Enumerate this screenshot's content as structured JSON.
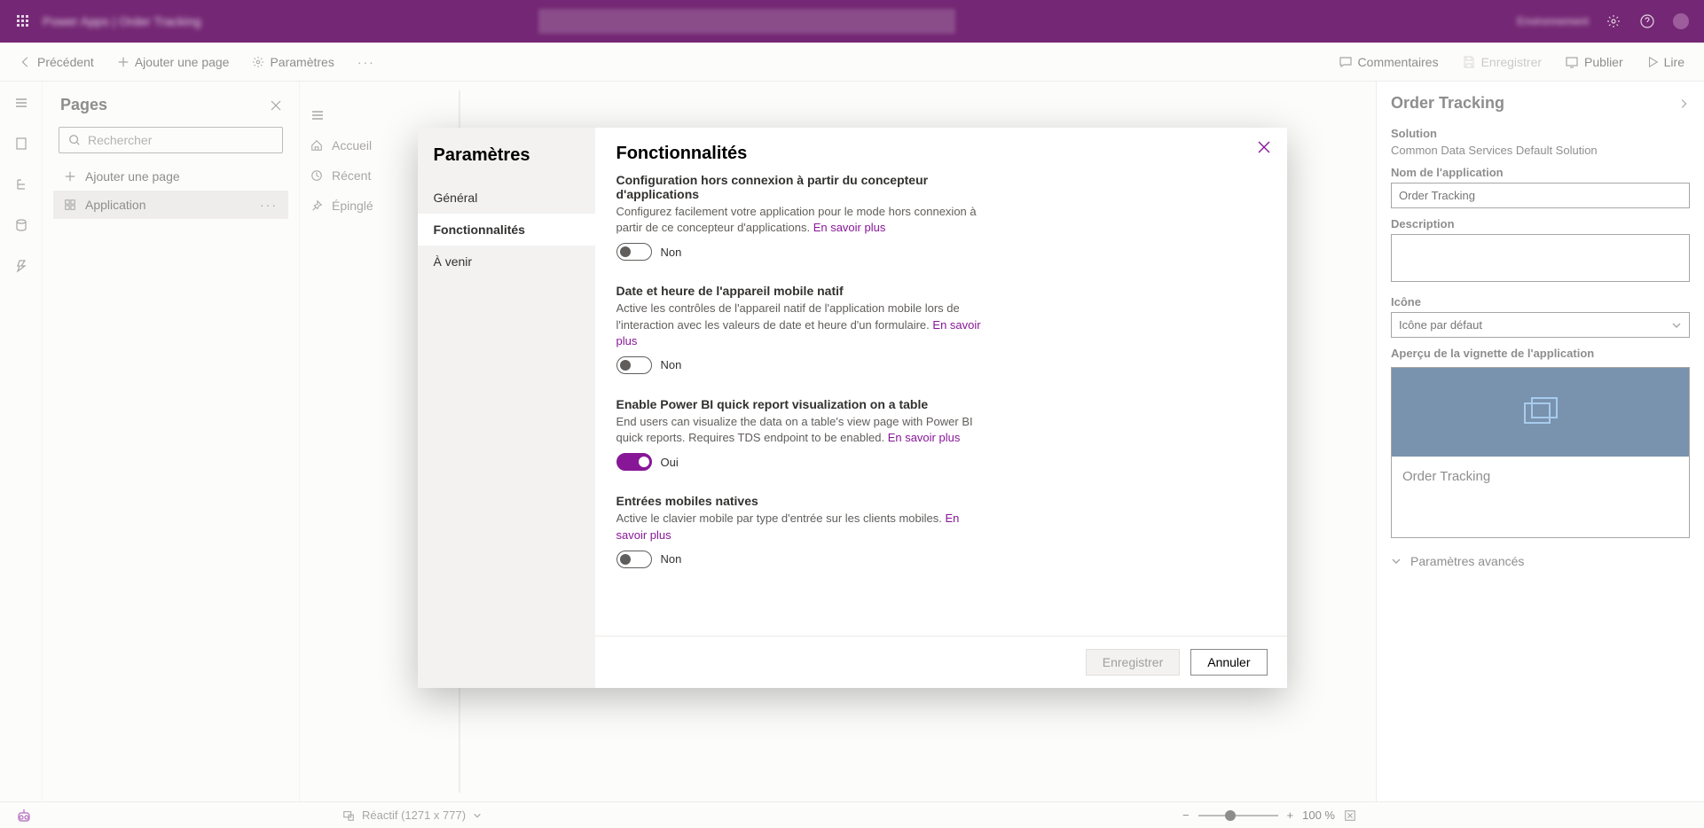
{
  "topbar": {
    "title": "Power Apps | Order Tracking",
    "user": "Environnement"
  },
  "cmdbar": {
    "back": "Précédent",
    "addPage": "Ajouter une page",
    "settings": "Paramètres",
    "comments": "Commentaires",
    "save": "Enregistrer",
    "publish": "Publier",
    "play": "Lire"
  },
  "pagesPanel": {
    "title": "Pages",
    "searchPlaceholder": "Rechercher",
    "addPage": "Ajouter une page",
    "items": [
      {
        "label": "Application"
      }
    ]
  },
  "canvasRail": {
    "hamburger": "",
    "items": [
      {
        "label": "Accueil"
      },
      {
        "label": "Récent"
      },
      {
        "label": "Épinglé"
      }
    ]
  },
  "rightPanel": {
    "title": "Order Tracking",
    "solutionLabel": "Solution",
    "solutionValue": "Common Data Services Default Solution",
    "appNameLabel": "Nom de l'application",
    "appNameValue": "Order Tracking",
    "descriptionLabel": "Description",
    "descriptionValue": "",
    "iconLabel": "Icône",
    "iconValue": "Icône par défaut",
    "tileLabel": "Aperçu de la vignette de l'application",
    "tileText": "Order Tracking",
    "advanced": "Paramètres avancés"
  },
  "modal": {
    "sideTitle": "Paramètres",
    "sideItems": [
      {
        "label": "Général"
      },
      {
        "label": "Fonctionnalités"
      },
      {
        "label": "À venir"
      }
    ],
    "title": "Fonctionnalités",
    "features": [
      {
        "title": "Configuration hors connexion à partir du concepteur d'applications",
        "desc": "Configurez facilement votre application pour le mode hors connexion à partir de ce concepteur d'applications.",
        "link": "En savoir plus",
        "on": false,
        "state": "Non"
      },
      {
        "title": "Date et heure de l'appareil mobile natif",
        "desc": "Active les contrôles de l'appareil natif de l'application mobile lors de l'interaction avec les valeurs de date et heure d'un formulaire.",
        "link": "En savoir plus",
        "on": false,
        "state": "Non"
      },
      {
        "title": "Enable Power BI quick report visualization on a table",
        "desc": "End users can visualize the data on a table's view page with Power BI quick reports. Requires TDS endpoint to be enabled.",
        "link": "En savoir plus",
        "on": true,
        "state": "Oui"
      },
      {
        "title": "Entrées mobiles natives",
        "desc": "Active le clavier mobile par type d'entrée sur les clients mobiles.",
        "link": "En savoir plus",
        "on": false,
        "state": "Non"
      }
    ],
    "saveBtn": "Enregistrer",
    "cancelBtn": "Annuler"
  },
  "statusbar": {
    "responsive": "Réactif (1271 x 777)",
    "zoom": "100 %"
  }
}
